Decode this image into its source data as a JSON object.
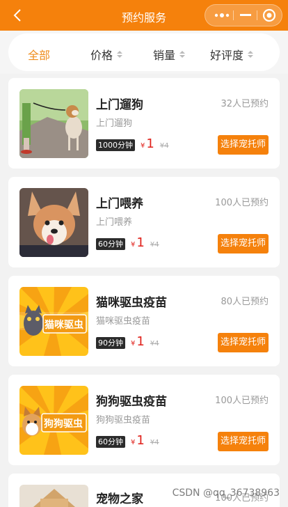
{
  "header": {
    "title": "预约服务"
  },
  "filters": [
    {
      "label": "全部",
      "active": true
    },
    {
      "label": "价格"
    },
    {
      "label": "销量"
    },
    {
      "label": "好评度"
    }
  ],
  "services": [
    {
      "name": "上门遛狗",
      "subtitle": "上门遛狗",
      "booked": "32人已预约",
      "duration": "1000分钟",
      "currency": "¥",
      "price": "1",
      "old_price": "¥4",
      "button": "选择宠托师",
      "image": "dog-walking-photo"
    },
    {
      "name": "上门喂养",
      "subtitle": "上门喂养",
      "booked": "100人已预约",
      "duration": "60分钟",
      "currency": "¥",
      "price": "1",
      "old_price": "¥4",
      "button": "选择宠托师",
      "image": "corgi-photo"
    },
    {
      "name": "猫咪驱虫疫苗",
      "subtitle": "猫咪驱虫疫苗",
      "booked": "80人已预约",
      "duration": "90分钟",
      "currency": "¥",
      "price": "1",
      "old_price": "¥4",
      "button": "选择宠托师",
      "image": "cat-deworming-banner",
      "banner_text": "猫咪驱虫"
    },
    {
      "name": "狗狗驱虫疫苗",
      "subtitle": "狗狗驱虫疫苗",
      "booked": "100人已预约",
      "duration": "60分钟",
      "currency": "¥",
      "price": "1",
      "old_price": "¥4",
      "button": "选择宠托师",
      "image": "dog-deworming-banner",
      "banner_text": "狗狗驱虫"
    },
    {
      "name": "宠物之家",
      "booked": "100人已预约",
      "image": "pet-house-photo"
    }
  ],
  "watermark": "CSDN @qq_36738963",
  "colors": {
    "brand": "#f5810c",
    "price": "#e0211b",
    "active_tab": "#ef8d1d"
  }
}
